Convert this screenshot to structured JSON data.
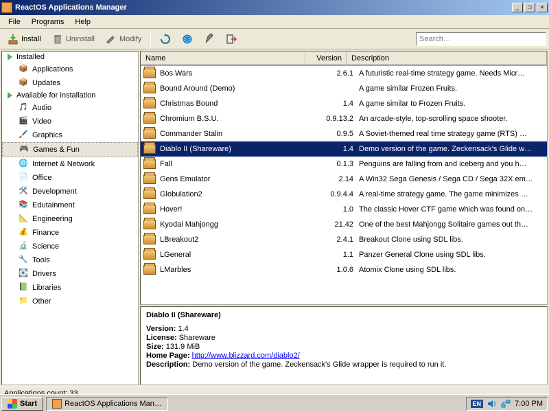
{
  "window": {
    "title": "ReactOS Applications Manager"
  },
  "menubar": [
    "File",
    "Programs",
    "Help"
  ],
  "toolbar": {
    "install": "Install",
    "uninstall": "Uninstall",
    "modify": "Modify"
  },
  "search": {
    "placeholder": "Search…"
  },
  "sidebar": {
    "installed": "Installed",
    "installed_children": [
      "Applications",
      "Updates"
    ],
    "available": "Available for installation",
    "categories": [
      "Audio",
      "Video",
      "Graphics",
      "Games & Fun",
      "Internet & Network",
      "Office",
      "Development",
      "Edutainment",
      "Engineering",
      "Finance",
      "Science",
      "Tools",
      "Drivers",
      "Libraries",
      "Other"
    ],
    "selected": "Games & Fun"
  },
  "columns": {
    "name": "Name",
    "version": "Version",
    "desc": "Description"
  },
  "apps": [
    {
      "name": "Bos Wars",
      "ver": "2.6.1",
      "desc": "A futuristic real-time strategy game. Needs Micr…"
    },
    {
      "name": "Bound Around (Demo)",
      "ver": "",
      "desc": "A game similar Frozen Fruits."
    },
    {
      "name": "Christmas Bound",
      "ver": "1.4",
      "desc": "A game similar to Frozen Fruits."
    },
    {
      "name": "Chromium B.S.U.",
      "ver": "0.9.13.2",
      "desc": "An arcade-style, top-scrolling space shooter."
    },
    {
      "name": "Commander Stalin",
      "ver": "0.9.5",
      "desc": "A Soviet-themed real time strategy game (RTS) …"
    },
    {
      "name": "Diablo II (Shareware)",
      "ver": "1.4",
      "desc": "Demo version of the game. Zeckensack's Glide w…"
    },
    {
      "name": "Fall",
      "ver": "0.1.3",
      "desc": "Penguins are falling from and iceberg and you h…"
    },
    {
      "name": "Gens Emulator",
      "ver": "2.14",
      "desc": "A Win32 Sega Genesis / Sega CD / Sega 32X em…"
    },
    {
      "name": "Globulation2",
      "ver": "0.9.4.4",
      "desc": "A real-time strategy game. The game minimizes …"
    },
    {
      "name": "Hover!",
      "ver": "1.0",
      "desc": "The classic Hover CTF game which was found on…"
    },
    {
      "name": "Kyodai Mahjongg",
      "ver": "21.42",
      "desc": "One of the best Mahjongg Solitaire games out th…"
    },
    {
      "name": "LBreakout2",
      "ver": "2.4.1",
      "desc": "Breakout Clone using SDL libs."
    },
    {
      "name": "LGeneral",
      "ver": "1.1",
      "desc": "Panzer General Clone using SDL libs."
    },
    {
      "name": "LMarbles",
      "ver": "1.0.6",
      "desc": "Atomix Clone using SDL libs."
    }
  ],
  "selected_app_index": 5,
  "details": {
    "title": "Diablo II (Shareware)",
    "version_label": "Version:",
    "version": "1.4",
    "license_label": "License:",
    "license": "Shareware",
    "size_label": "Size:",
    "size": "131.9 MiB",
    "homepage_label": "Home Page:",
    "homepage": "http://www.blizzard.com/diablo2/",
    "desc_label": "Description:",
    "desc": "Demo version of the game. Zeckensack's Glide wrapper is required to run it."
  },
  "statusbar": {
    "count_label": "Applications count:",
    "count": "33"
  },
  "taskbar": {
    "start": "Start",
    "task": "ReactOS Applications Man…",
    "lang": "EN",
    "time": "7:00 PM"
  }
}
